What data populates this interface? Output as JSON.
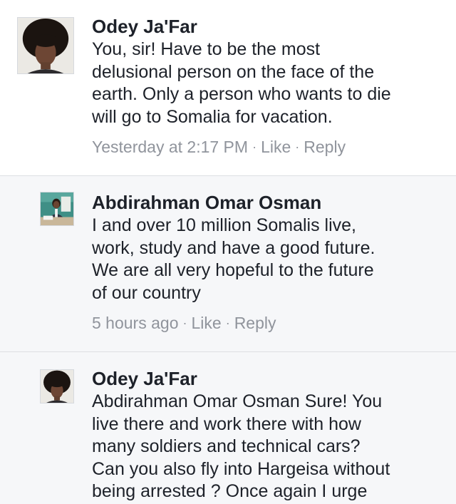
{
  "comments": [
    {
      "author": "Odey Ja'Far",
      "lines": [
        "You, sir! Have to be the most",
        "delusional person on the face of the",
        "earth. Only a person who wants to die",
        "will go to Somalia for vacation."
      ],
      "time": "Yesterday at 2:17 PM",
      "like": "Like",
      "reply": "Reply"
    },
    {
      "author": "Abdirahman Omar Osman",
      "lines": [
        "I and over 10 million Somalis live,",
        "work, study and have a good future.",
        "We are all very hopeful to the future",
        "of our country"
      ],
      "time": "5 hours ago",
      "like": "Like",
      "reply": "Reply"
    },
    {
      "author": "Odey Ja'Far",
      "lines": [
        "Abdirahman Omar Osman Sure! You",
        "live there and work there with how",
        "many soldiers and technical cars?",
        "Can you also fly into Hargeisa without",
        "being arrested ? Once again I urge"
      ]
    }
  ],
  "colors": {
    "text": "#1d2129",
    "meta": "#90949c",
    "reply_background": "#f6f7f9",
    "divider": "#dddfe2"
  }
}
